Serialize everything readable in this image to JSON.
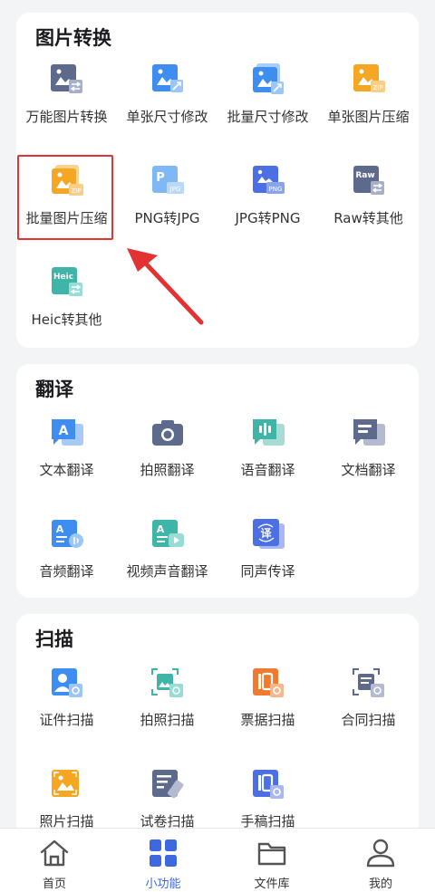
{
  "sections": [
    {
      "title": "图片转换",
      "items": [
        {
          "label": "万能图片转换",
          "icon": "image-convert-icon"
        },
        {
          "label": "单张尺寸修改",
          "icon": "image-resize-icon"
        },
        {
          "label": "批量尺寸修改",
          "icon": "batch-resize-icon"
        },
        {
          "label": "单张图片压缩",
          "icon": "image-compress-icon"
        },
        {
          "label": "批量图片压缩",
          "icon": "batch-compress-icon"
        },
        {
          "label": "PNG转JPG",
          "icon": "png-to-jpg-icon"
        },
        {
          "label": "JPG转PNG",
          "icon": "jpg-to-png-icon"
        },
        {
          "label": "Raw转其他",
          "icon": "raw-convert-icon"
        },
        {
          "label": "Heic转其他",
          "icon": "heic-convert-icon"
        }
      ]
    },
    {
      "title": "翻译",
      "items": [
        {
          "label": "文本翻译",
          "icon": "text-translate-icon"
        },
        {
          "label": "拍照翻译",
          "icon": "camera-translate-icon"
        },
        {
          "label": "语音翻译",
          "icon": "voice-translate-icon"
        },
        {
          "label": "文档翻译",
          "icon": "document-translate-icon"
        },
        {
          "label": "音频翻译",
          "icon": "audio-translate-icon"
        },
        {
          "label": "视频声音翻译",
          "icon": "video-translate-icon"
        },
        {
          "label": "同声传译",
          "icon": "simultaneous-translate-icon"
        }
      ]
    },
    {
      "title": "扫描",
      "items": [
        {
          "label": "证件扫描",
          "icon": "id-scan-icon"
        },
        {
          "label": "拍照扫描",
          "icon": "photo-scan-icon"
        },
        {
          "label": "票据扫描",
          "icon": "receipt-scan-icon"
        },
        {
          "label": "合同扫描",
          "icon": "contract-scan-icon"
        },
        {
          "label": "照片扫描",
          "icon": "picture-scan-icon"
        },
        {
          "label": "试卷扫描",
          "icon": "exam-scan-icon"
        },
        {
          "label": "手稿扫描",
          "icon": "manuscript-scan-icon"
        }
      ]
    }
  ],
  "icon_text": {
    "zip": "ZIP",
    "p": "P",
    "jpg": "JPG",
    "png": "PNG",
    "raw": "Raw",
    "heic": "Heic",
    "a": "A",
    "yi": "译"
  },
  "tabbar": {
    "items": [
      {
        "label": "首页",
        "icon": "home-icon"
      },
      {
        "label": "小功能",
        "icon": "grid-icon"
      },
      {
        "label": "文件库",
        "icon": "folder-icon"
      },
      {
        "label": "我的",
        "icon": "user-icon"
      }
    ],
    "active_index": 1
  },
  "colors": {
    "accent": "#3d68e0",
    "highlight": "#e23232",
    "orange": "#f5a623",
    "slate": "#5e6a8c",
    "teal": "#3fb5a8"
  }
}
